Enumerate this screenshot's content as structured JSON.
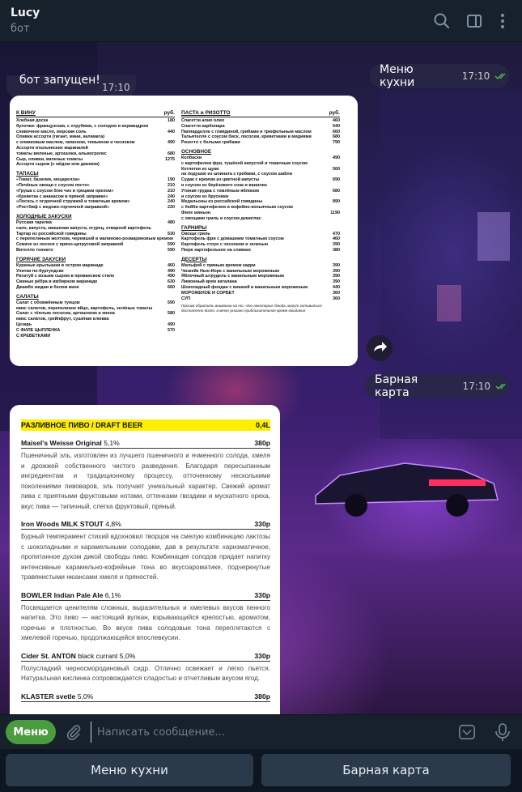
{
  "header": {
    "chat_name": "Lucy",
    "chat_status": "бот",
    "icons": [
      "search-icon",
      "sidebar-toggle-icon",
      "more-vertical-icon"
    ]
  },
  "messages": {
    "partial_top": {
      "text": "бот запущен!",
      "time": "17:10"
    },
    "kitchen_request": {
      "text": "Меню кухни",
      "time": "17:10",
      "read": true
    },
    "bar_request": {
      "text": "Барная карта",
      "time": "17:10",
      "read": true
    }
  },
  "kitchen_menu": {
    "left": {
      "head": {
        "title": "К ВИНУ",
        "unit": "руб."
      },
      "groups": [
        {
          "title": "",
          "items": [
            {
              "name": "Хлебная доска",
              "price": "180"
            },
            {
              "name": "булочки: французская, с отрубями, с солодом и кориандром",
              "price": ""
            },
            {
              "name": "сливочное масло, морская соль",
              "price": "440"
            },
            {
              "name": "Оливки ассорти (гигант, мини, каламата)",
              "price": ""
            },
            {
              "name": "с оливковым маслом, лимоном, тимьяном и чесноком",
              "price": "490"
            },
            {
              "name": "Ассорти итальянских мариналей",
              "price": ""
            },
            {
              "name": "томаты вяленые, артишоки, альмогролес",
              "price": "680"
            },
            {
              "name": "Сыр, оливки, вяленые томаты",
              "price": "1275"
            },
            {
              "name": "Ассорти сыров (с мёдом или джемом)",
              "price": ""
            }
          ]
        },
        {
          "title": "ТАПАСЫ",
          "items": [
            {
              "name": "«Томат, базилик, моцарелла»",
              "price": "190"
            },
            {
              "name": "«Печёные овощи с соусом песто»",
              "price": "210"
            },
            {
              "name": "«Груша с соусом блю чиз и грецким орехом»",
              "price": "210"
            },
            {
              "name": "«Креветка с ананасом в пряной заправке»",
              "price": "240"
            },
            {
              "name": "«Лосось с огуречной стружкой и томатным кремом»",
              "price": "240"
            },
            {
              "name": "«Ростбиф с медово-горчичной заправкой»",
              "price": "220"
            }
          ]
        },
        {
          "title": "ХОЛОДНЫЕ ЗАКУСКИ",
          "items": [
            {
              "name": "Русская тарелка",
              "price": "480"
            },
            {
              "name": "сало, капуста, квашеная капуста, огурец, отварной картофель",
              "price": ""
            },
            {
              "name": "Тартар из российской говядины",
              "price": "530"
            },
            {
              "name": "с перепелиным желтком, черемшой и малиново-розмариновым кремом",
              "price": ""
            },
            {
              "name": "Севиче из лосося с пряно-цитрусовой заправкой",
              "price": "590"
            },
            {
              "name": "Вителло тоннато",
              "price": "590"
            }
          ]
        },
        {
          "title": "ГОРЯЧИЕ ЗАКУСКИ",
          "items": [
            {
              "name": "Куриные крылышки в остром маринаде",
              "price": "460"
            },
            {
              "name": "Улитки по-бургундски",
              "price": "490"
            },
            {
              "name": "Рататуй с козьим сыром в прованском стиле",
              "price": "490"
            },
            {
              "name": "Свиные рёбра в имбирном маринаде",
              "price": "630"
            },
            {
              "name": "Джамбо мидии в белом вине",
              "price": "660"
            }
          ]
        },
        {
          "title": "САЛАТЫ",
          "items": [
            {
              "name": "Салат с обожжённым тунцом",
              "price": "590"
            },
            {
              "name": "микс салатов, перепелиное яйцо, картофель, зелёные томаты",
              "price": ""
            },
            {
              "name": "Салат с тёплым лососем, артишоком и киноа",
              "price": "580"
            },
            {
              "name": "микс салатов, грейпфрут, сушёная клюква",
              "price": ""
            },
            {
              "name": "Цезарь",
              "price": "490"
            },
            {
              "name": "С ФИЛЕ ЦЫПЛЁНКА",
              "price": "570"
            },
            {
              "name": "С КРЕВЕТКАМИ",
              "price": ""
            }
          ]
        }
      ]
    },
    "right": {
      "head": {
        "title": "ПАСТА и РИЗОТТО",
        "unit": "руб."
      },
      "groups": [
        {
          "title": "",
          "items": [
            {
              "name": "Спагетти алио олио",
              "price": "460"
            },
            {
              "name": "Спагетти карбонара",
              "price": "540"
            },
            {
              "name": "Паппарделле с говядиной, грибами и трюфельным маслом",
              "price": "660"
            },
            {
              "name": "Тальятелле с соусом биск, лососем, креветками и мидиями",
              "price": "680"
            },
            {
              "name": "Ризотто с белыми грибами",
              "price": "790"
            }
          ]
        },
        {
          "title": "ОСНОВНОЕ",
          "items": [
            {
              "name": "Колбаски",
              "price": "490"
            },
            {
              "name": "с картофелем фри, тушёной капустой и томатным соусом",
              "price": ""
            },
            {
              "name": "Котлетки из щуки",
              "price": "560"
            },
            {
              "name": "на подушке из шпината с грибами, с соусом шабли",
              "price": ""
            },
            {
              "name": "Судак с кремом из цветной капусты",
              "price": "690"
            },
            {
              "name": "и соусом из берёзового сока и ванилиэ",
              "price": ""
            },
            {
              "name": "Утиная грудка с томлёным яблоком",
              "price": "680"
            },
            {
              "name": "и соусом из брусники",
              "price": ""
            },
            {
              "name": "Медальоны из российской говядины",
              "price": "890"
            },
            {
              "name": "с бейби картофелем и кофейно-коньячным соусом",
              "price": ""
            },
            {
              "name": "Филе миньон",
              "price": "1190"
            },
            {
              "name": "с овощами гриль и соусом демиглас",
              "price": ""
            }
          ]
        },
        {
          "title": "ГАРНИРЫ",
          "items": [
            {
              "name": "Овощи гриль",
              "price": "470"
            },
            {
              "name": "Картофель фри с домашним томатным соусом",
              "price": "460"
            },
            {
              "name": "Картофель стоун с чесноком и зеленью",
              "price": "390"
            },
            {
              "name": "Пюре картофельное на сливках",
              "price": "380"
            }
          ]
        },
        {
          "title": "ДЕСЕРТЫ",
          "items": [
            {
              "name": "Мильфей с пряным кремом карри",
              "price": "390"
            },
            {
              "name": "Чизкейк Нью-Йорк с ванильным мороженым",
              "price": "390"
            },
            {
              "name": "Яблочный штрудель с ванильным мороженым",
              "price": "390"
            },
            {
              "name": "Лимонный крем каталана",
              "price": "390"
            },
            {
              "name": "Шоколадный фондан с вишней и ванильным мороженым",
              "price": "440"
            }
          ]
        },
        {
          "title": "",
          "items": [
            {
              "name": "МОРОЖЕНОЕ И СОРБЕТ",
              "price": "360"
            },
            {
              "name": "СУП",
              "price": "360"
            }
          ]
        }
      ],
      "note": "Просим обратить внимание на то, что некоторые блюда, могут готовиться достаточно долго, в меню указано приблизительное время ожидания"
    }
  },
  "bar_menu": {
    "header": {
      "title": "РАЗЛИВНОЕ ПИВО / DRAFT BEER",
      "volume": "0,4L"
    },
    "items": [
      {
        "name": "Maisel's Weisse Original",
        "abv": "5,1%",
        "price": "380р",
        "desc": "Пшеничный эль, изготовлен из лучшего пшеничного и ячменного солода, хмеля и дрожжей собственного чистого разведения. Благодаря пересыпанным ингредиентам и традиционному процессу, отточенному несколькими поколениями пивоваров, эль получает уникальный характер. Свежий аромат пива с приятными фруктовыми нотами, оттенками гвоздики и мускатного ореха, вкус пива — типичный, слегка фруктовый, пряный."
      },
      {
        "name": "Iron Woods MILK STOUT",
        "abv": "4,8%",
        "price": "330р",
        "desc": "Бурный темперамент стихий вдохновил творцов на смелую комбинацию лактозы с шоколадными и карамельными солодами, дав в результате харизматичное, пропитанное духом дикой свободы пиво. Комбинация солодов придает напитку интенсивные карамельно-кофейные тона во вкусоароматике, подчеркнутые травянистыми нюансами хмеля и пряностей."
      },
      {
        "name": "BOWLER Indian Pale Ale",
        "abv": "6,1%",
        "price": "330р",
        "desc": "Посвящается ценителям сложных, выразительных и хмелевых вкусов пенного напитка. Это пиво — настоящий вулкан, взрывающийся крепостью, ароматом, горечью и плотностью. Во вкусе пива солодовые тона переплетаются с хмелевой горечью, продолжающейся впослевкусии."
      },
      {
        "name": "Cider St. ANTON",
        "abv": "black currant 5,0%",
        "price": "330р",
        "desc": "Полусладкий черносмородиновый сидр. Отлично освежает и легко пьется. Натуральная кислинка сопровождается сладостью и отчетливым вкусом ягод."
      },
      {
        "name": "KLASTER svetle",
        "abv": "5,0%",
        "price": "380р",
        "desc": ""
      }
    ]
  },
  "input": {
    "menu_button": "Меню",
    "placeholder": "Написать сообщение..."
  },
  "keyboard": {
    "buttons": [
      "Меню кухни",
      "Барная карта"
    ]
  },
  "colors": {
    "header_bg": "#17212b",
    "menu_button": "#4b9b3f",
    "keyboard_button": "#2b3a4a",
    "highlight_yellow": "#ffee00",
    "read_check": "#4fae4e"
  }
}
